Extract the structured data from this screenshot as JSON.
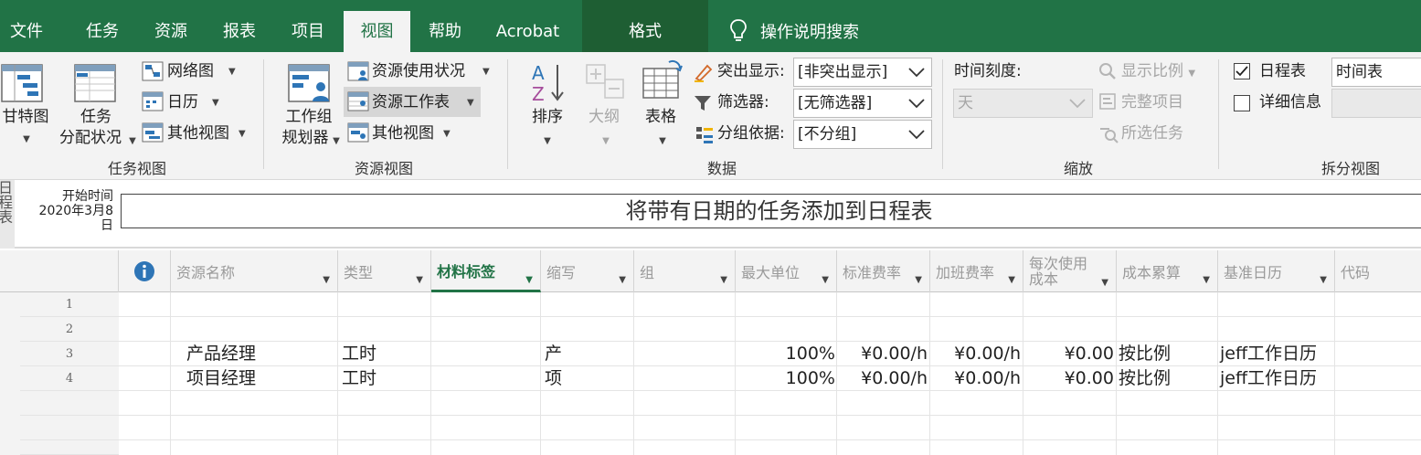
{
  "tabs": [
    "文件",
    "任务",
    "资源",
    "报表",
    "项目",
    "视图",
    "帮助",
    "Acrobat"
  ],
  "active_tab": "视图",
  "format_tab": "格式",
  "search_label": "操作说明搜索",
  "ribbon": {
    "task_views": {
      "gantt": "甘特图",
      "task_usage_1": "任务",
      "task_usage_2": "分配状况",
      "network": "网络图",
      "calendar": "日历",
      "other_views": "其他视图",
      "group_label": "任务视图"
    },
    "resource_views": {
      "team_planner_1": "工作组",
      "team_planner_2": "规划器",
      "resource_usage": "资源使用状况",
      "resource_sheet": "资源工作表",
      "other_views": "其他视图",
      "group_label": "资源视图"
    },
    "data": {
      "sort": "排序",
      "outline": "大纲",
      "tables": "表格",
      "highlight_label": "突出显示:",
      "highlight_value": "[非突出显示]",
      "filter_label": "筛选器:",
      "filter_value": "[无筛选器]",
      "group_label_text": "分组依据:",
      "group_value": "[不分组]",
      "group_label": "数据"
    },
    "zoom": {
      "timescale_label": "时间刻度:",
      "timescale_value": "天",
      "zoom_ratio": "显示比例",
      "entire_project": "完整项目",
      "selected_tasks": "所选任务",
      "group_label": "缩放"
    },
    "split_view": {
      "timeline": "日程表",
      "details": "详细信息",
      "timeline_dropdown": "时间表",
      "group_label": "拆分视图",
      "timeline_checked": true,
      "details_checked": false
    }
  },
  "timeline": {
    "side_label": "日程表",
    "start_label": "开始时间",
    "start_date": "2020年3月8日",
    "placeholder": "将带有日期的任务添加到日程表"
  },
  "grid": {
    "columns": [
      "资源名称",
      "类型",
      "材料标签",
      "缩写",
      "组",
      "最大单位",
      "标准费率",
      "加班费率",
      "每次使用成本",
      "成本累算",
      "基准日历",
      "代码"
    ],
    "per_use_line1": "每次使用",
    "per_use_line2": "成本",
    "row_numbers": [
      "1",
      "2",
      "3",
      "4"
    ],
    "rows": [
      {
        "name": "产品经理",
        "type": "工时",
        "abbr": "产",
        "max_units": "100%",
        "std_rate": "¥0.00/h",
        "ovt_rate": "¥0.00/h",
        "cost_per_use": "¥0.00",
        "accrue": "按比例",
        "calendar": "jeff工作日历"
      },
      {
        "name": "项目经理",
        "type": "工时",
        "abbr": "项",
        "max_units": "100%",
        "std_rate": "¥0.00/h",
        "ovt_rate": "¥0.00/h",
        "cost_per_use": "¥0.00",
        "accrue": "按比例",
        "calendar": "jeff工作日历"
      }
    ]
  },
  "colors": {
    "brand": "#217346",
    "format_group": "#1e5e33",
    "ribbon": "#f3f3f3",
    "info_icon": "#2e75b6"
  }
}
